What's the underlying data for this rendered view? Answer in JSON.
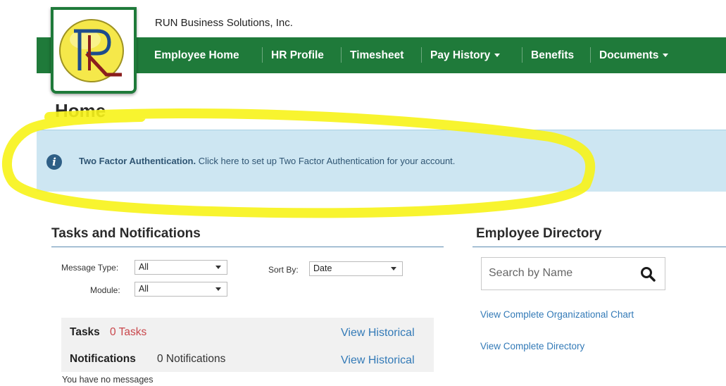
{
  "company_name": "RUN Business Solutions, Inc.",
  "nav": {
    "employee_home": "Employee Home",
    "hr_profile": "HR Profile",
    "timesheet": "Timesheet",
    "pay_history": "Pay History",
    "benefits": "Benefits",
    "documents": "Documents"
  },
  "page_title": "Home",
  "alert": {
    "icon": "info-icon",
    "title": "Two Factor Authentication.",
    "message": "Click here to set up Two Factor Authentication for your account."
  },
  "tasks_section": {
    "title": "Tasks and Notifications",
    "message_type_label": "Message Type:",
    "message_type_value": "All",
    "module_label": "Module:",
    "module_value": "All",
    "sort_by_label": "Sort By:",
    "sort_by_value": "Date",
    "tasks_label": "Tasks",
    "tasks_count": "0 Tasks",
    "notifications_label": "Notifications",
    "notifications_count": "0 Notifications",
    "view_historical": "View Historical",
    "no_messages": "You have no messages"
  },
  "directory": {
    "title": "Employee Directory",
    "search_placeholder": "Search by Name",
    "org_chart_link": "View Complete Organizational Chart",
    "directory_link": "View Complete Directory"
  },
  "colors": {
    "nav_green": "#1f7a3a",
    "alert_bg": "#cde6f2",
    "link_blue": "#337ab7",
    "task_count_red": "#c9464b",
    "highlight_yellow": "#f7f318"
  }
}
